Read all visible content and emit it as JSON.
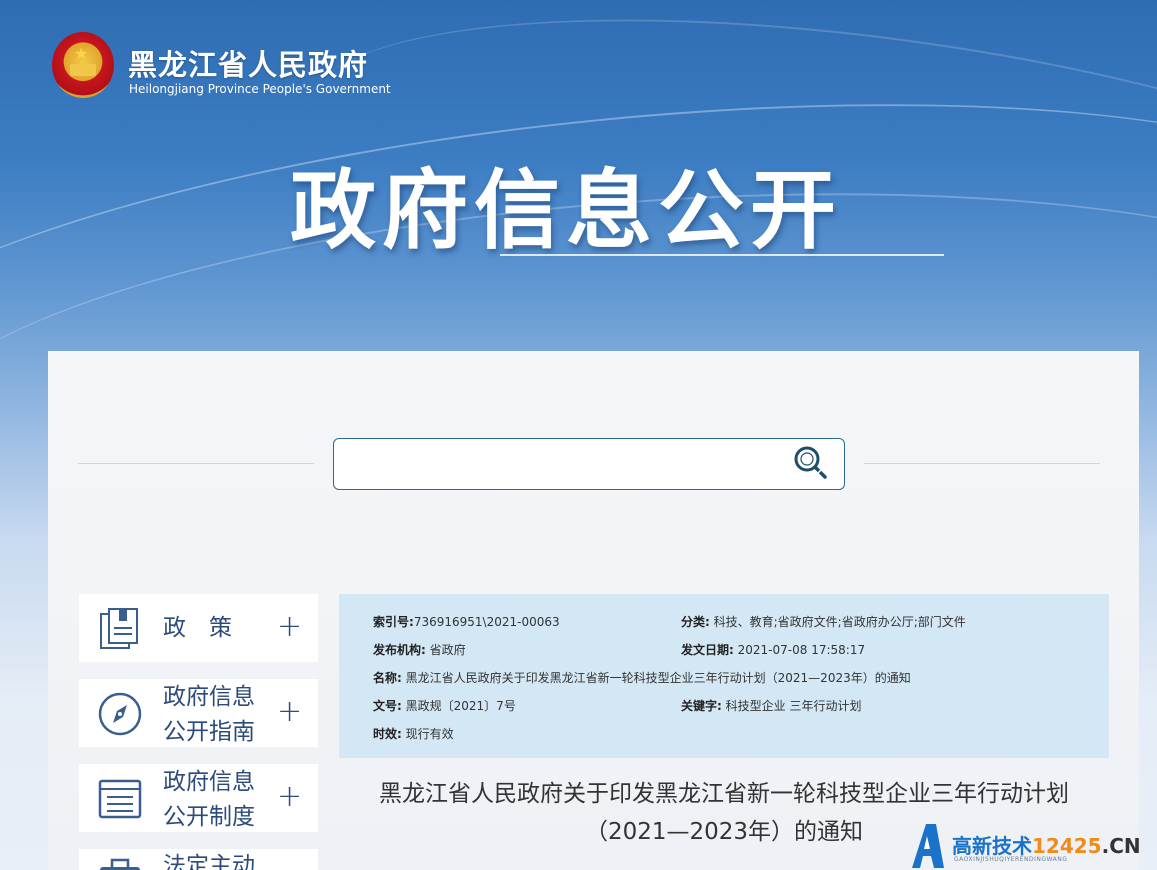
{
  "header": {
    "site_title": "黑龙江省人民政府",
    "site_subtitle": "Heilongjiang Province People's Government",
    "big_title": "政府信息公开"
  },
  "search": {
    "placeholder": ""
  },
  "sidebar": {
    "items": [
      {
        "line1": "政　策",
        "line2": "",
        "plus": "+",
        "icon": "document-book-icon"
      },
      {
        "line1": "政府信息",
        "line2": "公开指南",
        "plus": "+",
        "icon": "compass-icon"
      },
      {
        "line1": "政府信息",
        "line2": "公开制度",
        "plus": "+",
        "icon": "list-document-icon"
      },
      {
        "line1": "法定主动",
        "line2": "",
        "plus": "",
        "icon": "briefcase-icon"
      }
    ]
  },
  "info": {
    "index_label": "索引号:",
    "index_value": "736916951\\2021-00063",
    "category_label": "分类:",
    "category_value": "科技、教育;省政府文件;省政府办公厅;部门文件",
    "publisher_label": "发布机构:",
    "publisher_value": "省政府",
    "date_label": "发文日期:",
    "date_value": "2021-07-08 17:58:17",
    "name_label": "名称:",
    "name_value": "黑龙江省人民政府关于印发黑龙江省新一轮科技型企业三年行动计划（2021—2023年）的通知",
    "docno_label": "文号:",
    "docno_value": "黑政规〔2021〕7号",
    "keyword_label": "关键字:",
    "keyword_value": "科技型企业 三年行动计划",
    "validity_label": "时效:",
    "validity_value": "现行有效"
  },
  "document": {
    "title_line1": "黑龙江省人民政府关于印发黑龙江省新一轮科技型企业三年行动计划",
    "title_line2": "（2021—2023年）的通知"
  },
  "watermark": {
    "text": "高新技术",
    "number": "12425",
    "suffix": ".CN",
    "sub": "GAOXINJISHUQIYERENDINGWANG"
  },
  "colors": {
    "primary_blue": "#2f6db3",
    "nav_text": "#2b4b7a",
    "info_bg": "#d4e7f5",
    "search_border": "#2c6a8f"
  }
}
